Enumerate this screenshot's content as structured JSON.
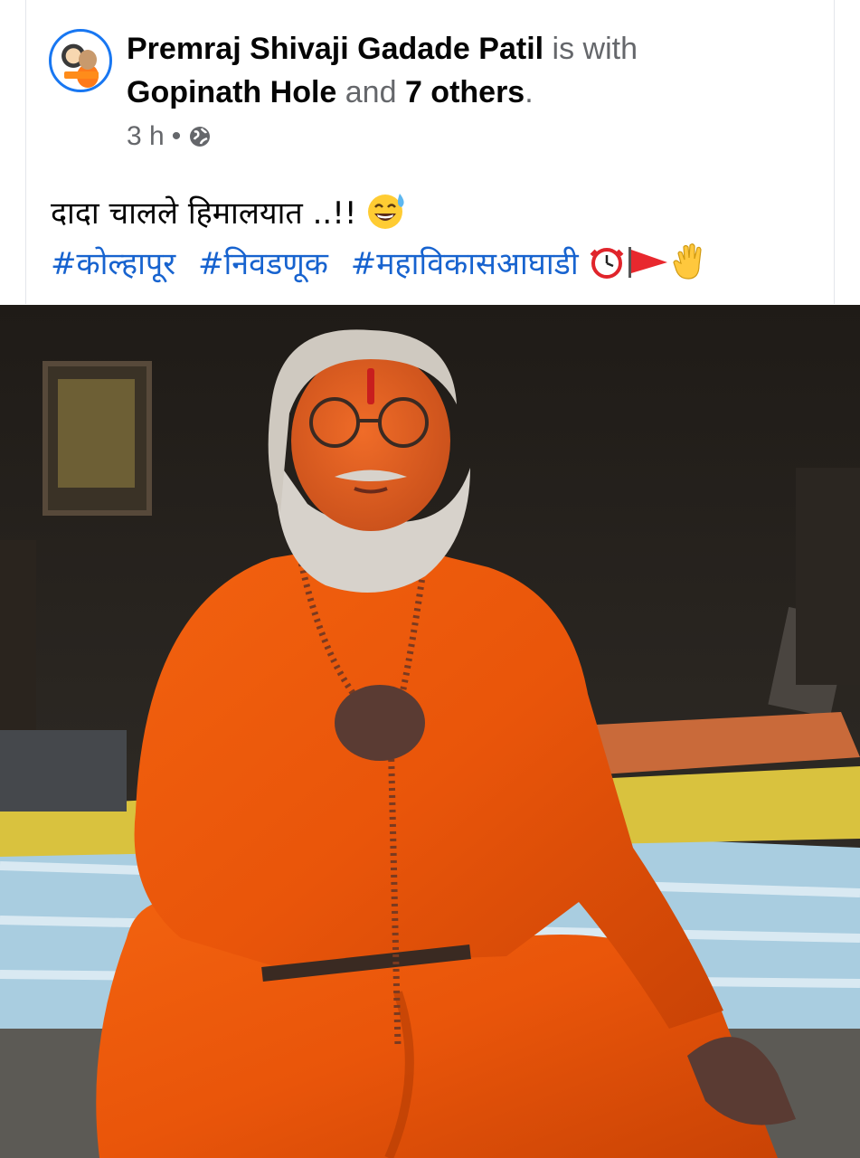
{
  "post": {
    "author": "Premraj Shivaji Gadade Patil",
    "with_text": " is with ",
    "tagged_name": "Gopinath Hole",
    "and_text": " and ",
    "others": "7 others",
    "period": ".",
    "time": "3 h",
    "separator": "•",
    "privacy_icon": "globe-icon",
    "caption": "दादा चालले हिमालयात ..!!",
    "caption_emoji": "grinning-sweat-icon",
    "hashtags": [
      "#कोल्हापूर",
      "#निवडणूक",
      "#महाविकासआघाडी"
    ],
    "trailing_emojis": [
      "alarm-clock-icon",
      "red-flag-icon",
      "raised-hand-icon"
    ]
  },
  "colors": {
    "link": "#1763cf",
    "text": "#050505",
    "secondary": "#65676b",
    "avatar_ring": "#1877f2"
  }
}
